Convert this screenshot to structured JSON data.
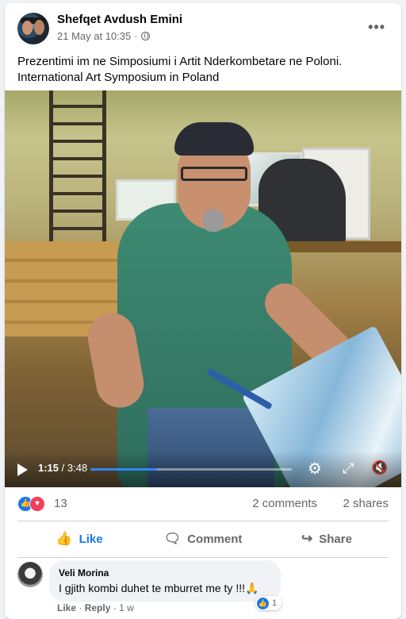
{
  "post": {
    "author": "Shefqet Avdush Emini",
    "date": "21 May at 10:35",
    "dot": "·",
    "more_icon": "•••",
    "caption_line1": "Prezentimi im ne Simposiumi i Artit Nderkombetare ne Poloni.",
    "caption_line2": "International Art Symposium in Poland"
  },
  "video": {
    "current_time": "1:15",
    "total_time": "3:48",
    "progress_fraction": 0.33,
    "icons": [
      "play-icon",
      "gear-icon",
      "fullscreen-icon",
      "volume-mute-icon"
    ]
  },
  "stats": {
    "reactions_count": "13",
    "comments": "2 comments",
    "shares": "2 shares"
  },
  "actions": {
    "like": "Like",
    "comment": "Comment",
    "share": "Share"
  },
  "comment": {
    "author": "Veli Morina",
    "text": "I gjith kombi duhet te mburret me ty !!!🙏",
    "reaction_count": "1",
    "like_link": "Like",
    "reply_link": "Reply",
    "age": "1 w"
  },
  "colors": {
    "accent": "#1877f2",
    "love": "#f33e58",
    "secondary_text": "#65676b"
  }
}
